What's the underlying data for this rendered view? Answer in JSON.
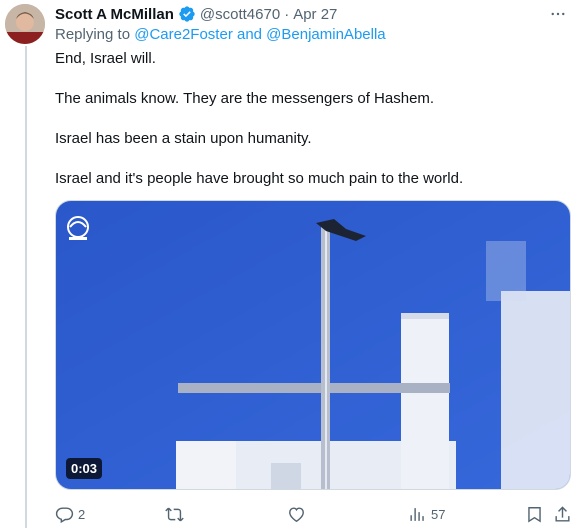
{
  "tweet": {
    "author_name": "Scott A McMillan",
    "handle": "@scott4670",
    "separator": "·",
    "date": "Apr 27",
    "replying_to_prefix": "Replying to",
    "replying_to_users": "@Care2Foster and @BenjaminAbella",
    "paragraphs": [
      "End, Israel will.",
      "The animals know. They are the messengers of Hashem.",
      "Israel has been a stain upon humanity.",
      "Israel and it's people have brought so much pain to the world."
    ],
    "video_time": "0:03",
    "actions": {
      "replies": "2",
      "retweets": "",
      "likes": "",
      "views": "57"
    }
  },
  "colors": {
    "accent": "#1d9bf0",
    "text": "#0f1419",
    "muted": "#536471",
    "sky": "#2d5fd4"
  },
  "icons": [
    "verified-badge-icon",
    "more-icon",
    "reply-icon",
    "retweet-icon",
    "like-icon",
    "views-icon",
    "bookmark-icon",
    "share-icon",
    "channel-logo-icon"
  ]
}
